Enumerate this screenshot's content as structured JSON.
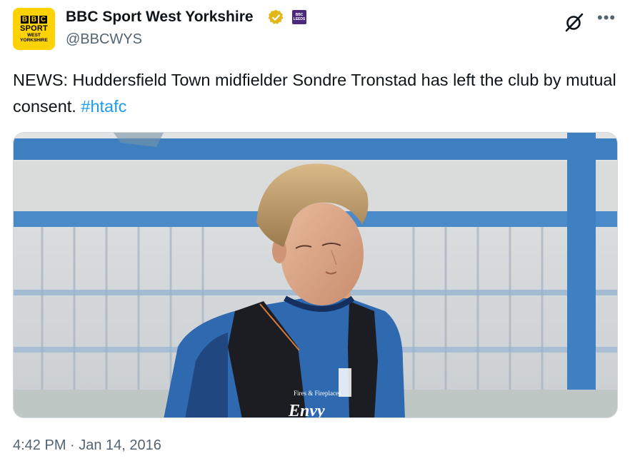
{
  "account": {
    "display_name": "BBC Sport West Yorkshire",
    "handle": "@BBCWYS",
    "avatar_top": "BBC",
    "avatar_mid": "SPORT",
    "avatar_sub1": "WEST",
    "avatar_sub2": "YORKSHIRE",
    "affiliate_badge_top": "BBC",
    "affiliate_badge_bottom": "LEEDS",
    "verified_badge_color": "#e2b719"
  },
  "tweet": {
    "text": "NEWS: Huddersfield Town midfielder Sondre Tronstad has left the club by mutual consent. ",
    "hashtag": "#htafc",
    "timestamp": "4:42 PM · Jan 14, 2016"
  },
  "media": {
    "shirt_sponsor_line1": "Fires & Fireplaces",
    "shirt_sponsor_line2": "Envy"
  },
  "icons": {
    "more": "more-icon",
    "grok": "grok-icon",
    "verified": "verified-badge-icon"
  },
  "colors": {
    "link": "#1d9bf0",
    "secondary_text": "#536471"
  }
}
